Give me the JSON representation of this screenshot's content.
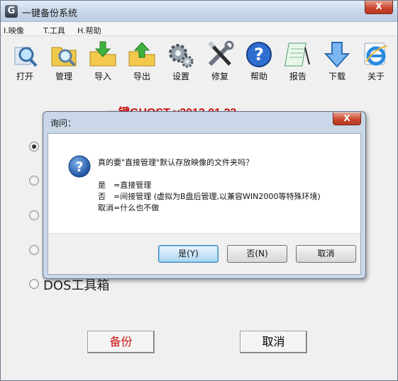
{
  "window": {
    "title": "一键备份系统",
    "app_icon": "G",
    "close_label": "X"
  },
  "menu": [
    "I.映像",
    "T.工具",
    "H.帮助"
  ],
  "toolbar": [
    {
      "label": "打开",
      "icon": "open-icon"
    },
    {
      "label": "管理",
      "icon": "manage-icon"
    },
    {
      "label": "导入",
      "icon": "import-icon"
    },
    {
      "label": "导出",
      "icon": "export-icon"
    },
    {
      "label": "设置",
      "icon": "settings-icon"
    },
    {
      "label": "修复",
      "icon": "repair-icon"
    },
    {
      "label": "帮助",
      "icon": "help-icon"
    },
    {
      "label": "报告",
      "icon": "report-icon"
    },
    {
      "label": "下载",
      "icon": "download-icon"
    },
    {
      "label": "关于",
      "icon": "about-icon"
    }
  ],
  "main": {
    "heading": "一键GHOST v2013.01.23",
    "last_option": "DOS工具箱",
    "backup_button": "备份",
    "cancel_button": "取消"
  },
  "dialog": {
    "title": "询问：",
    "close_label": "X",
    "question": "真的要\"直接管理\"默认存放映像的文件夹吗？",
    "line_yes": "是　=直接管理",
    "line_no": "否　=间接管理 (虚拟为B盘后管理,以兼容WIN2000等特殊环境)",
    "line_cancel": "取消=什么也不做",
    "buttons": {
      "yes": "是(Y)",
      "no": "否(N)",
      "cancel": "取消"
    }
  },
  "colors": {
    "heading": "#cc1111",
    "dialog_frame": "#c9d7e8",
    "default_button": "#cde6f7"
  }
}
